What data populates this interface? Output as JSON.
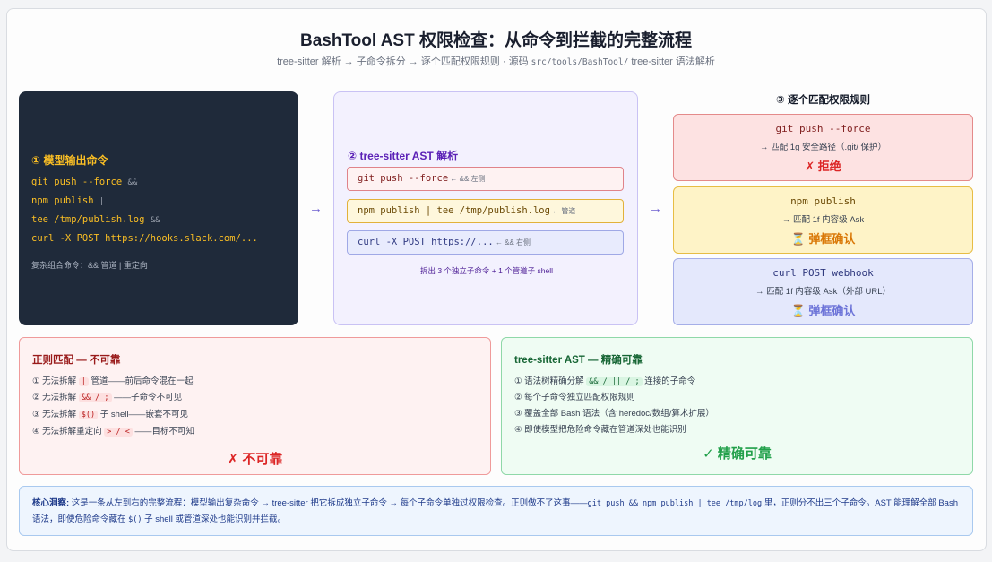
{
  "title": "BashTool AST 权限检查：从命令到拦截的完整流程",
  "subtitle": {
    "pre": "tree-sitter 解析 → 子命令拆分 → 逐个匹配权限规则 · 源码 ",
    "path": "src/tools/BashTool/",
    "post": " tree-sitter 语法解析"
  },
  "panel1": {
    "heading": "① 模型输出命令",
    "lines": [
      {
        "cmd": "git push --force",
        "op": "&&"
      },
      {
        "cmd": "npm publish",
        "op": "|"
      },
      {
        "cmd": "tee /tmp/publish.log",
        "op": "&&"
      },
      {
        "cmd": "curl -X POST https://hooks.slack.com/...",
        "op": ""
      }
    ],
    "note": "复杂组合命令：&& 管道 | 重定向"
  },
  "arrows": [
    "→",
    "→"
  ],
  "panel2": {
    "heading": "② tree-sitter AST 解析",
    "commands": [
      {
        "cmd": "git push --force",
        "tag": " ← && 左侧"
      },
      {
        "cmd": "npm publish | tee /tmp/publish.log",
        "tag": " ← 管道"
      },
      {
        "cmd": "curl -X POST https://...",
        "tag": " ← && 右侧"
      }
    ],
    "footer": "拆出 3 个独立子命令 + 1 个管道子 shell"
  },
  "panel3": {
    "heading": "③ 逐个匹配权限规则",
    "rules": [
      {
        "cmd": "git push --force",
        "desc": "→ 匹配 1g 安全路径（.git/ 保护）",
        "verdict": "✗ 拒绝"
      },
      {
        "cmd": "npm publish",
        "desc": "→ 匹配 1f 内容级 Ask",
        "verdict": "⏳ 弹框确认"
      },
      {
        "cmd": "curl POST webhook",
        "desc": "→ 匹配 1f 内容级 Ask（外部 URL）",
        "verdict": "⏳ 弹框确认"
      }
    ]
  },
  "regex_panel": {
    "heading": "正则匹配 — 不可靠",
    "items": [
      {
        "pre": "① 无法拆解 ",
        "code": "|",
        "post": " 管道——前后命令混在一起"
      },
      {
        "pre": "② 无法拆解 ",
        "code": "&& / ;",
        "post": " ——子命令不可见"
      },
      {
        "pre": "③ 无法拆解 ",
        "code": "$()",
        "post": " 子 shell——嵌套不可见"
      },
      {
        "pre": "④ 无法拆解重定向 ",
        "code": "> / <",
        "post": " ——目标不可知"
      }
    ],
    "verdict": "✗ 不可靠"
  },
  "ast_panel": {
    "heading": "tree-sitter AST — 精确可靠",
    "items": [
      {
        "pre": "① 语法树精确分解 ",
        "code": "&& / || / ;",
        "post": " 连接的子命令"
      },
      {
        "pre": "② 每个子命令独立匹配权限规则",
        "code": "",
        "post": ""
      },
      {
        "pre": "③ 覆盖全部 Bash 语法（含 heredoc/数组/算术扩展）",
        "code": "",
        "post": ""
      },
      {
        "pre": "④ 即使模型把危险命令藏在管道深处也能识别",
        "code": "",
        "post": ""
      }
    ],
    "verdict": "✓ 精确可靠"
  },
  "insight": {
    "label": "核心洞察:",
    "part1": " 这是一条从左到右的完整流程：模型输出复杂命令 → tree-sitter 把它拆成独立子命令 → 每个子命令单独过权限检查。正则做不了这事——",
    "code1": "git push && npm publish | tee /tmp/log",
    "part2": " 里，正则分不出三个子命令。AST 能理解全部 Bash 语法，即使危险命令藏在 ",
    "code2": "$()",
    "part3": " 子 shell 或管道深处也能识别并拦截。"
  }
}
